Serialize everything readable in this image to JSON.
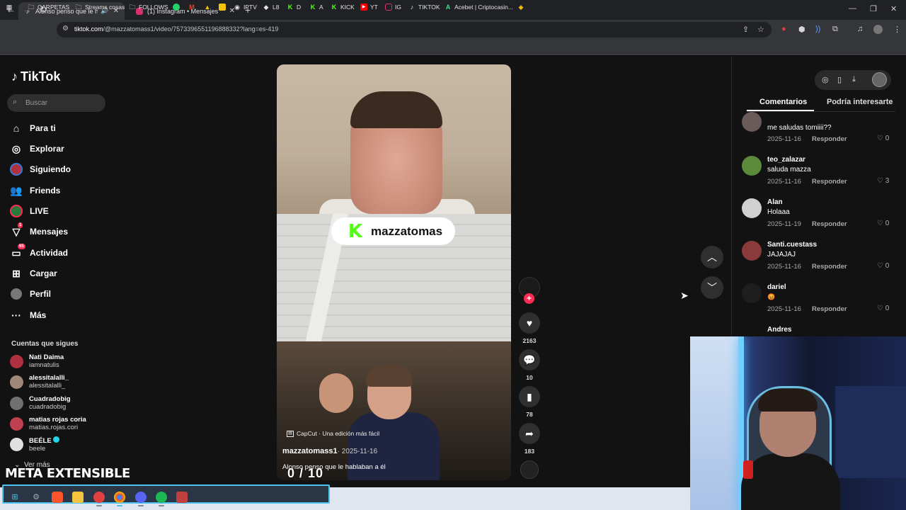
{
  "browser": {
    "tabs": [
      {
        "title": "Alonso penso que le habla",
        "active": true
      },
      {
        "title": "(1) Instagram • Mensajes",
        "active": false
      }
    ],
    "url_host": "tiktok.com",
    "url_path": "/@mazzatomass1/video/7573396551196888332?lang=es-419",
    "bookmarks": [
      "CARPETAS",
      "Streams cosas",
      "FOLLOWS",
      "IPTV",
      "L8",
      "D",
      "A",
      "KICK",
      "YT",
      "IG",
      "TIKTOK",
      "Acebet | Criptocasin..."
    ]
  },
  "tiktok": {
    "logo": "TikTok",
    "search_placeholder": "Buscar",
    "nav": [
      {
        "label": "Para ti",
        "icon": "home-icon"
      },
      {
        "label": "Explorar",
        "icon": "compass-icon"
      },
      {
        "label": "Siguiendo",
        "icon": "following-avatar-icon"
      },
      {
        "label": "Friends",
        "icon": "friends-icon"
      },
      {
        "label": "LIVE",
        "icon": "live-icon"
      },
      {
        "label": "Mensajes",
        "icon": "messages-icon",
        "badge": "1"
      },
      {
        "label": "Actividad",
        "icon": "activity-icon",
        "badge": "65"
      },
      {
        "label": "Cargar",
        "icon": "upload-icon"
      },
      {
        "label": "Perfil",
        "icon": "profile-icon"
      },
      {
        "label": "Más",
        "icon": "more-icon"
      }
    ],
    "following_title": "Cuentas que sigues",
    "following": [
      {
        "name": "Nati Daima",
        "handle": "iamnatulis",
        "color": "#b03040"
      },
      {
        "name": "alessitalalli_",
        "handle": "alessitalalli_",
        "color": "#a08878"
      },
      {
        "name": "Cuadradobig",
        "handle": "cuadradobig",
        "color": "#707070"
      },
      {
        "name": "matias rojas coria",
        "handle": "matias.rojas.cori",
        "color": "#c04050"
      },
      {
        "name": "BEÉLE",
        "handle": "beele",
        "color": "#e0e0e0",
        "verified": true
      }
    ],
    "see_more": "Ver más"
  },
  "video": {
    "overlay_brand": "mazzatomas",
    "capcut_label": "CapCut · Una edición más fácil",
    "author": "mazzatomass1",
    "date": "· 2025-11-16",
    "description": "Alonso penso que le hablaban a él",
    "counter": "0  / 10"
  },
  "actions": {
    "likes": "2163",
    "comments": "10",
    "saves": "78",
    "shares": "183"
  },
  "panel": {
    "tab_comments": "Comentarios",
    "tab_interest": "Podría interesarte",
    "reply_label": "Responder",
    "comments": [
      {
        "user": "",
        "text": "me saludas tomiiii??",
        "date": "2025-11-16",
        "likes": "0",
        "color": "#6a5a5a"
      },
      {
        "user": "teo_zalazar",
        "text": "saluda mazza",
        "date": "2025-11-16",
        "likes": "3",
        "color": "#5a8a3a"
      },
      {
        "user": "Alan",
        "text": "Holaaa",
        "date": "2025-11-19",
        "likes": "0",
        "color": "#d0d0d0"
      },
      {
        "user": "Santi.cuestass",
        "text": "JAJAJAJ",
        "date": "2025-11-16",
        "likes": "0",
        "color": "#8a3a3a"
      },
      {
        "user": "dariel",
        "text": "😡",
        "date": "2025-11-16",
        "likes": "0",
        "color": "#1e1e1e"
      },
      {
        "user": "Andres",
        "text": "",
        "date": "",
        "likes": "",
        "color": "#333"
      }
    ]
  },
  "overlay": {
    "meta_text": "META EXTENSIBLE"
  }
}
